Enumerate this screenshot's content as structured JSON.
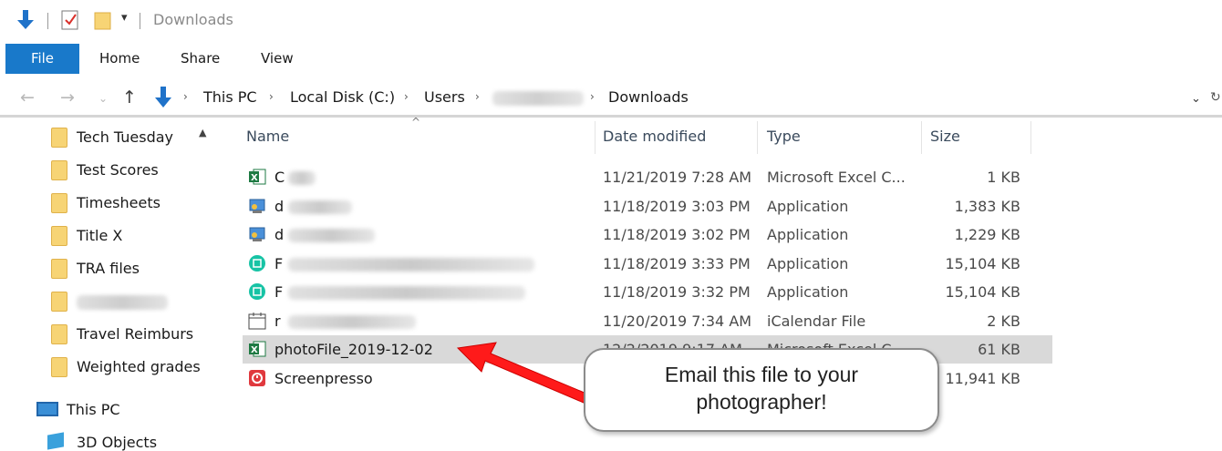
{
  "window": {
    "title": "Downloads"
  },
  "ribbon": {
    "tabs": [
      "File",
      "Home",
      "Share",
      "View"
    ]
  },
  "address": {
    "segments": [
      "This PC",
      "Local Disk (C:)",
      "Users",
      "Downloads"
    ]
  },
  "nav": {
    "folders": [
      "Tech Tuesday",
      "Test Scores",
      "Timesheets",
      "Title X",
      "TRA files",
      "",
      "Travel Reimburs",
      "Weighted grades"
    ],
    "this_pc": "This PC",
    "objects": "3D Objects"
  },
  "columns": {
    "name": "Name",
    "date": "Date modified",
    "type": "Type",
    "size": "Size"
  },
  "files": [
    {
      "name": "C",
      "date": "11/21/2019 7:28 AM",
      "type": "Microsoft Excel C...",
      "size": "1 KB",
      "icon": "excel-icon"
    },
    {
      "name": "d",
      "date": "11/18/2019 3:03 PM",
      "type": "Application",
      "size": "1,383 KB",
      "icon": "installer-icon"
    },
    {
      "name": "d",
      "date": "11/18/2019 3:02 PM",
      "type": "Application",
      "size": "1,229 KB",
      "icon": "installer-icon"
    },
    {
      "name": "F",
      "date": "11/18/2019 3:33 PM",
      "type": "Application",
      "size": "15,104 KB",
      "icon": "teal-app-icon"
    },
    {
      "name": "F",
      "date": "11/18/2019 3:32 PM",
      "type": "Application",
      "size": "15,104 KB",
      "icon": "teal-app-icon"
    },
    {
      "name": "r",
      "date": "11/20/2019 7:34 AM",
      "type": "iCalendar File",
      "size": "2 KB",
      "icon": "calendar-icon"
    },
    {
      "name": "photoFile_2019-12-02",
      "date": "12/2/2019 9:17 AM",
      "type": "Microsoft Excel C...",
      "size": "61 KB",
      "icon": "excel-icon"
    },
    {
      "name": "Screenpresso",
      "date": "",
      "type": "",
      "size": "11,941 KB",
      "icon": "screenpresso-icon"
    }
  ],
  "callout": {
    "line1": "Email this file to your",
    "line2": "photographer!"
  },
  "colors": {
    "accent": "#1979ca",
    "arrow": "#ff1a1a",
    "selected_row": "#d9d9d9"
  }
}
